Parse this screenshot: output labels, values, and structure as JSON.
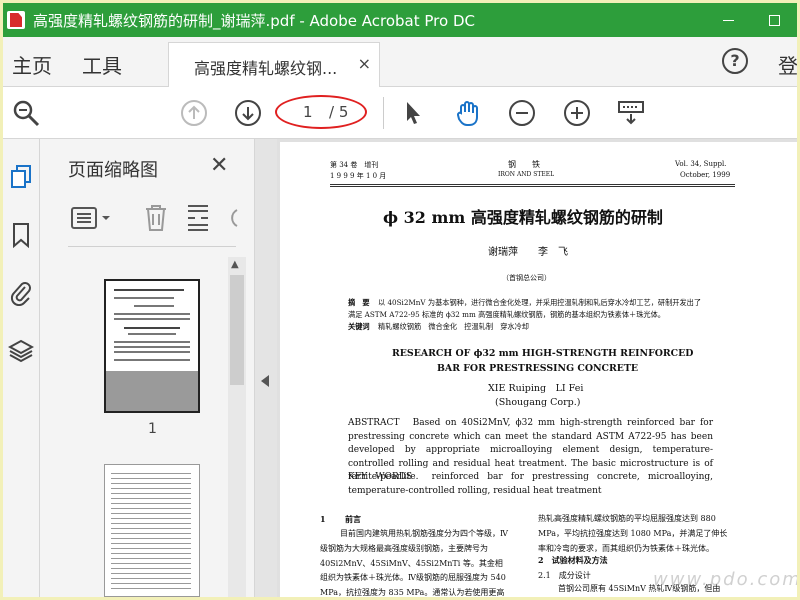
{
  "window": {
    "title": "高强度精轧螺纹钢筋的研制_谢瑞萍.pdf - Adobe Acrobat Pro DC"
  },
  "menubar": {
    "home": "主页",
    "tools": "工具",
    "tab_label": "高强度精轧螺纹钢...",
    "tab_close": "×",
    "help": "?",
    "login": "登"
  },
  "toolbar": {
    "current_page": "1",
    "total_pages": "/ 5"
  },
  "thumbnail_panel": {
    "title": "页面缩略图",
    "close": "✕",
    "page1_label": "1"
  },
  "document": {
    "header_left_1": "第 34 卷　增刊",
    "header_left_2": "1 9 9 9 年 1 0 月",
    "header_center_1": "钢　　铁",
    "header_center_2": "IRON AND STEEL",
    "header_right_1": "Vol. 34, Suppl.",
    "header_right_2": "October, 1999",
    "title": "ϕ 32 mm 高强度精轧螺纹钢筋的研制",
    "authors": "谢瑞萍　　李　飞",
    "affiliation": "（首钢总公司）",
    "abstract_label": "摘　要",
    "abstract_cn_1": "以 40Si2MnV 为基本钢种，进行微合金化处理，并采用控温轧制和轧后穿水冷却工艺，研制开发出了",
    "abstract_cn_2": "满足 ASTM A722-95 标准的 ϕ32 mm 高强度精轧螺纹钢筋，钢筋的基本组织为铁素体＋珠光体。",
    "keywords_label": "关键词",
    "keywords_cn": "精轧螺纹钢筋　微合金化　控温轧制　穿水冷却",
    "en_title_1": "RESEARCH OF ϕ32 mm HIGH-STRENGTH REINFORCED",
    "en_title_2": "BAR FOR PRESTRESSING CONCRETE",
    "en_authors": "XIE Ruiping　LI Fei",
    "en_affiliation": "(Shougang Corp.)",
    "en_abstract": "ABSTRACT　Based on 40Si2MnV, ϕ32 mm high-strength reinforced bar for prestressing concrete which can meet the standard ASTM A722-95 has been developed by appropriate microalloying element design, temperature-controlled rolling and residual heat treatment. The basic microstructure is of ferrite-pearlite.",
    "en_keywords": "KEY WORDS　reinforced bar for prestressing concrete, microalloying, temperature-controlled rolling, residual heat treatment",
    "sec1_num": "1",
    "sec1_title": "前言",
    "col_left": "目前国内建筑用热轧钢筋强度分为四个等级，Ⅳ级钢筋为大规格最高强度级别钢筋，主要牌号为 40Si2MnV、45SiMnV、45Si2MnTi 等。其金相组织为铁素体＋珠光体。Ⅳ级钢筋的屈服强度为 540 MPa，抗拉强度为 835 MPa。通常认为若使用更高强度的钢筋，需要电处理，因为如果依靠增加合金",
    "col_right_1": "热轧高强度精轧螺纹钢筋的平均屈服强度达到 880 MPa，平均抗拉强度达到 1080 MPa，并满足了伸长率和冷弯的要求，而其组织仍为铁素体＋珠光体。",
    "sec2_title": "2　试验材料及方法",
    "sec21_title": "2.1　成分设计",
    "col_right_2": "首钢公司原有 45SiMnV 热轧Ⅳ级钢筋，但由于在现在的生产工艺，但是要想满足三种工程"
  },
  "watermark": "www.pdo.com"
}
